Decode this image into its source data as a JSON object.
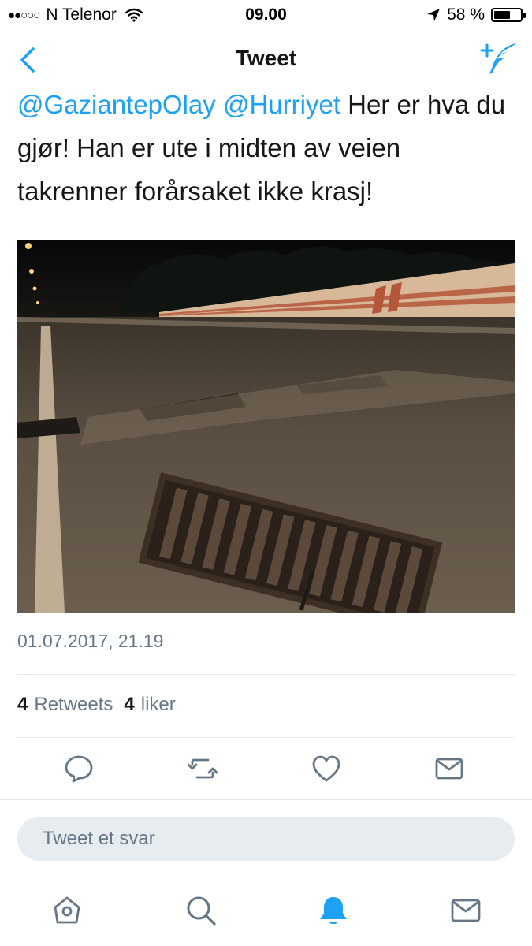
{
  "status_bar": {
    "signal_dots": "●●○○○",
    "carrier": "N Telenor",
    "time": "09.00",
    "battery_percent": "58 %",
    "battery_level": 0.58
  },
  "nav": {
    "title": "Tweet",
    "back_icon": "chevron-left-icon",
    "compose_icon": "compose-tweet-icon"
  },
  "tweet": {
    "mention_1": "@GaziantepOlay",
    "mention_2": "@Hurriyet",
    "text": " Her er hva du gjør! Han er ute i midten av veien takrenner forårsaket ikke krasj!",
    "timestamp": "01.07.2017, 21.19",
    "retweet_count": "4",
    "retweet_label": "Retweets",
    "like_count": "4",
    "like_label": "liker"
  },
  "actions": [
    "reply-icon",
    "retweet-icon",
    "like-icon",
    "direct-message-icon"
  ],
  "reply": {
    "placeholder": "Tweet et svar"
  },
  "tab_bar": [
    "home-icon",
    "search-icon",
    "notifications-icon",
    "messages-icon"
  ],
  "colors": {
    "accent": "#1da1f2",
    "secondary_text": "#657786",
    "divider": "#e1e8ed"
  }
}
